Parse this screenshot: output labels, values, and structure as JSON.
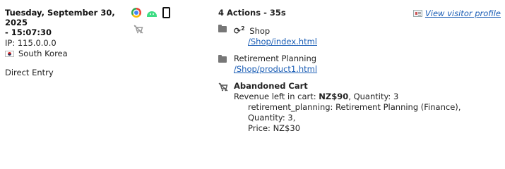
{
  "visit": {
    "date_line1": "Tuesday, September 30, 2025",
    "date_line2": "- 15:07:30",
    "ip": "IP: 115.0.0.0",
    "country": "South Korea",
    "referrer": "Direct Entry"
  },
  "icons": {
    "browser": "chrome-icon",
    "os": "android-icon",
    "device": "smartphone-icon",
    "ecommerce": "abandoned-cart-icon"
  },
  "summary": "4 Actions - 35s",
  "visitor_profile_link": "View visitor profile",
  "actions": [
    {
      "icon": "folder-icon",
      "reload_count": "2",
      "title": "Shop",
      "url": "/Shop/index.html"
    },
    {
      "icon": "folder-icon",
      "title": "Retirement Planning",
      "url": "/Shop/product1.html"
    }
  ],
  "abandoned_cart": {
    "title": "Abandoned Cart",
    "revenue_label": "Revenue left in cart:",
    "revenue_value": "NZ$90",
    "quantity_text": ", Quantity: 3",
    "item_line": "retirement_planning: Retirement Planning (Finance), Quantity: 3,",
    "price_line": "Price: NZ$30"
  }
}
